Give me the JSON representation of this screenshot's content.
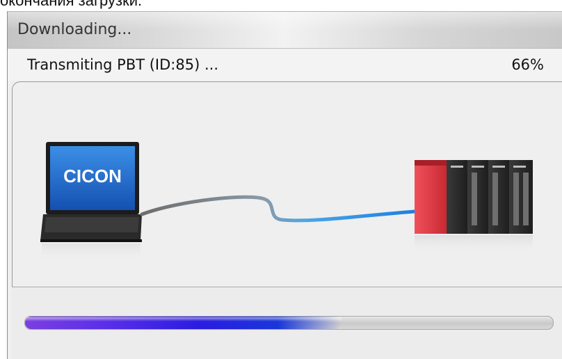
{
  "caption": "окончания загрузки.",
  "window": {
    "title": "Downloading..."
  },
  "status": {
    "message": "Transmiting PBT (ID:85) ...",
    "percent_label": "66%"
  },
  "illustration": {
    "laptop_logo": "CICON",
    "laptop_icon": "laptop-icon",
    "cable_icon": "cable-icon",
    "plc_icon": "plc-rack-icon"
  },
  "progress": {
    "fraction": 0.6
  },
  "colors": {
    "progress_start": "#7a3fe0",
    "progress_end": "#1a37d8",
    "plc_red": "#d8323c",
    "screen_blue": "#1f6fd0"
  }
}
